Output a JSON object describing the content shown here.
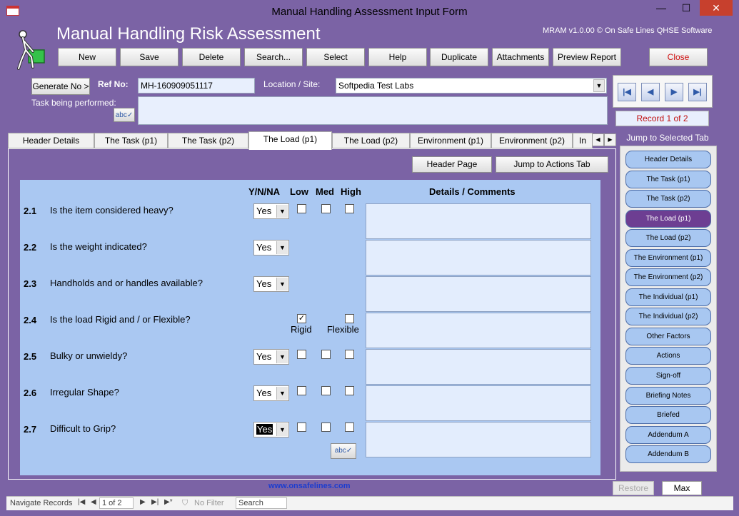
{
  "window": {
    "title": "Manual Handling Assessment Input Form",
    "minimize": "—",
    "maximize": "☐",
    "close": "✕"
  },
  "header": {
    "app_title": "Manual Handling Risk Assessment",
    "version": "MRAM v1.0.00 © On Safe Lines QHSE Software",
    "toolbar": [
      "New",
      "Save",
      "Delete",
      "Search...",
      "Select",
      "Help",
      "Duplicate",
      "Attachments",
      "Preview Report"
    ],
    "close_label": "Close"
  },
  "form": {
    "generate_label": "Generate No >",
    "ref_label": "Ref No:",
    "ref_value": "MH-160909051117",
    "location_label": "Location / Site:",
    "location_value": "Softpedia Test Labs",
    "task_label": "Task being performed:",
    "task_value": ""
  },
  "nav": {
    "first": "|◀",
    "prev": "◀",
    "next": "▶",
    "last": "▶|",
    "record": "Record 1 of 2"
  },
  "tabs": [
    "Header Details",
    "The Task (p1)",
    "The Task (p2)",
    "The Load (p1)",
    "The Load (p2)",
    "Environment (p1)",
    "Environment (p2)",
    "In"
  ],
  "tab_active": "The Load (p1)",
  "page_buttons": {
    "header_page": "Header Page",
    "jump_actions": "Jump to Actions Tab"
  },
  "columns": {
    "ynna": "Y/N/NA",
    "low": "Low",
    "med": "Med",
    "high": "High",
    "details": "Details / Comments"
  },
  "questions": [
    {
      "num": "2.1",
      "text": "Is the item considered heavy?",
      "answer": "Yes"
    },
    {
      "num": "2.2",
      "text": "Is the weight indicated?",
      "answer": "Yes"
    },
    {
      "num": "2.3",
      "text": "Handholds and or handles available?",
      "answer": "Yes"
    },
    {
      "num": "2.4",
      "text": "Is the load Rigid and / or Flexible?",
      "rigid": "Rigid",
      "flexible": "Flexible"
    },
    {
      "num": "2.5",
      "text": "Bulky or unwieldy?",
      "answer": "Yes"
    },
    {
      "num": "2.6",
      "text": "Irregular Shape?",
      "answer": "Yes"
    },
    {
      "num": "2.7",
      "text": "Difficult to Grip?",
      "answer": "Yes"
    }
  ],
  "side": {
    "jump_label": "Jump to Selected Tab",
    "buttons": [
      "Header Details",
      "The Task (p1)",
      "The Task (p2)",
      "The Load (p1)",
      "The Load (p2)",
      "The Environment (p1)",
      "The Environment (p2)",
      "The Individual (p1)",
      "The Individual (p2)",
      "Other Factors",
      "Actions",
      "Sign-off",
      "Briefing Notes",
      "Briefed",
      "Addendum A",
      "Addendum B"
    ],
    "active": "The Load (p1)",
    "restore": "Restore",
    "max": "Max"
  },
  "footer_url": "www.onsafelines.com",
  "statusbar": {
    "navigate": "Navigate Records",
    "record": "1 of 2",
    "filter": "No Filter",
    "search": "Search"
  },
  "icons": {
    "spell": "abc-check-icon",
    "logo": "person-lifting-box-icon"
  },
  "colors": {
    "frame": "#7b63a5",
    "panel": "#aac8f2",
    "active_side": "#6d3e92",
    "close_red": "#d01010"
  }
}
